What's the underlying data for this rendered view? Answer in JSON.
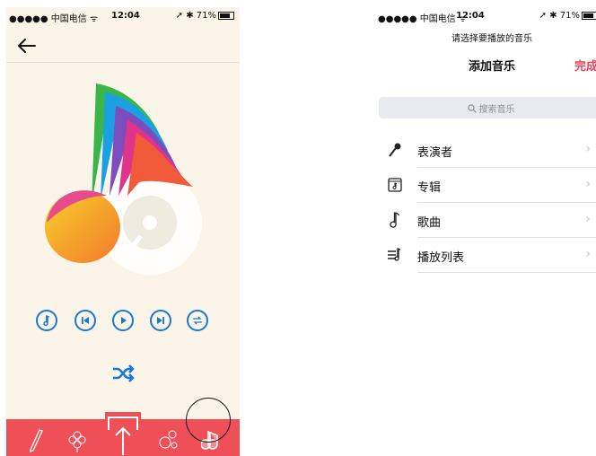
{
  "left_screen": {
    "status_bar": {
      "carrier": "●●●●● 中国电信 ᯤ",
      "time": "12:04",
      "battery": "➚ ✱ 71%"
    },
    "back_icon": "arrow-left-icon",
    "player_controls": [
      "music-note-icon",
      "previous-icon",
      "play-icon",
      "next-icon",
      "repeat-icon"
    ],
    "shuffle_icon": "shuffle-icon",
    "tab_bar": {
      "background": "#ef5058",
      "tabs": [
        "pencil-icon",
        "flower-icon",
        "upload-icon",
        "circles-icon",
        "music-sticker-icon"
      ]
    },
    "accent_color": "#1877d2"
  },
  "right_screen": {
    "status_bar": {
      "carrier": "●●●●● 中国电信 ᯤ",
      "time": "12:04",
      "battery": "➚ ✱ 71%"
    },
    "prompt": "请选择要播放的音乐",
    "title": "添加音乐",
    "done_label": "完成",
    "done_color": "#ef3f5a",
    "search_placeholder": "搜索音乐",
    "items": [
      {
        "label": "表演者",
        "icon": "microphone-icon"
      },
      {
        "label": "专辑",
        "icon": "album-icon"
      },
      {
        "label": "歌曲",
        "icon": "music-note-icon"
      },
      {
        "label": "播放列表",
        "icon": "playlist-icon"
      }
    ]
  }
}
